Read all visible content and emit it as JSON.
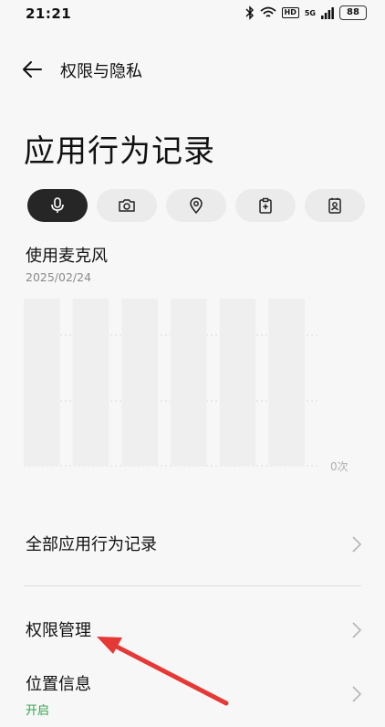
{
  "status_bar": {
    "time": "21:21",
    "hd_badge": "HD",
    "network": "5G",
    "battery": "88"
  },
  "header": {
    "title": "权限与隐私"
  },
  "page": {
    "title": "应用行为记录"
  },
  "filter_chips": [
    {
      "icon": "microphone-icon",
      "active": true
    },
    {
      "icon": "camera-icon",
      "active": false
    },
    {
      "icon": "location-pin-icon",
      "active": false
    },
    {
      "icon": "clipboard-icon",
      "active": false
    },
    {
      "icon": "contacts-icon",
      "active": false
    }
  ],
  "usage": {
    "title": "使用麦克风",
    "date": "2025/02/24"
  },
  "chart_data": {
    "type": "bar",
    "y_tick_label": "0次",
    "bar_count": 6,
    "values": [
      0,
      0,
      0,
      0,
      0,
      0
    ],
    "grid": true
  },
  "menu": {
    "all_records": "全部应用行为记录",
    "permission_management": "权限管理",
    "location_info": "位置信息",
    "location_status": "开启"
  },
  "colors": {
    "active_chip": "#262626",
    "status_on": "#2fa34a",
    "annotation_arrow": "#e53935"
  }
}
